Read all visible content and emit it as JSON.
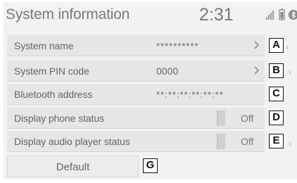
{
  "header": {
    "title": "System information",
    "time": "2:31"
  },
  "rows": [
    {
      "label": "System name",
      "value": "**********",
      "callout": "A"
    },
    {
      "label": "System PIN code",
      "value": "0000",
      "callout": "B"
    },
    {
      "label": "Bluetooth address",
      "value": "**:**:**:**:**:**",
      "callout": "C"
    },
    {
      "label": "Display phone status",
      "toggle": "Off",
      "callout": "D"
    },
    {
      "label": "Display audio player status",
      "toggle": "Off",
      "callout": "E"
    }
  ],
  "default_button": {
    "label": "Default",
    "callout": "G"
  },
  "colors": {
    "screen_bg": "#f2f2f2",
    "row_bg": "#e6e6e6",
    "text": "#666666",
    "callout_border": "#111111"
  },
  "icons": [
    "signal-icon",
    "battery-icon",
    "bluetooth-icon",
    "chevron-right-icon"
  ]
}
